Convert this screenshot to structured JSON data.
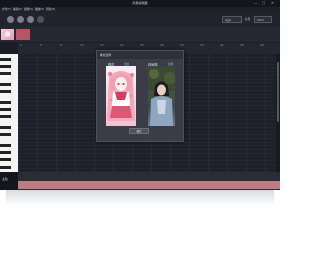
{
  "window": {
    "title": "简易编辑器",
    "controls": [
      "—",
      "□",
      "✕"
    ]
  },
  "menu": [
    "文件(F)",
    "编辑(E)",
    "视图(V)",
    "播放(P)",
    "帮助(H)"
  ],
  "toolbar": {
    "select_value": "乐谱1",
    "label": "标签",
    "zoom_value": "100%"
  },
  "ruler": {
    "numbers": [
      "1",
      "5",
      "9",
      "13",
      "17",
      "21",
      "25",
      "29",
      "33",
      "37",
      "41",
      "45",
      "49"
    ]
  },
  "bottom": {
    "left_label": "主轨"
  },
  "dialog": {
    "title": "角色选择",
    "close": "✕",
    "left_name": "樱花",
    "left_link": "更换",
    "right_name": "林间路",
    "right_link": "更换",
    "confirm": "确定"
  },
  "colors": {
    "background": "#1c1e27",
    "accent_pink": "#c07c84",
    "link": "#8fb4ff"
  }
}
